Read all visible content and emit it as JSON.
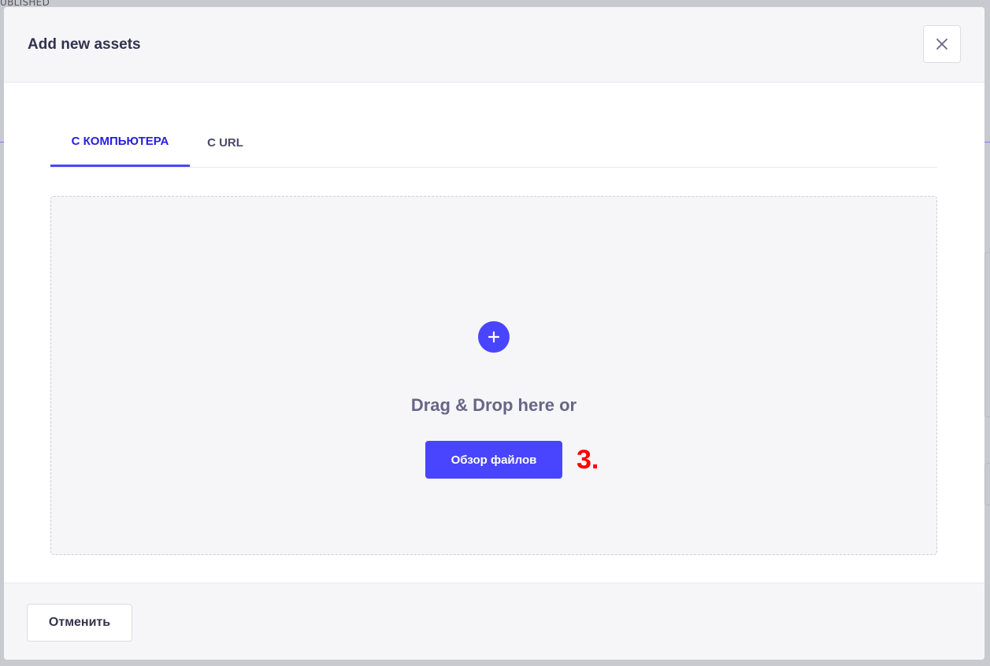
{
  "background": {
    "status_fragment": "UBLISHED"
  },
  "modal": {
    "title": "Add new assets",
    "close_icon": "close-icon",
    "tabs": [
      {
        "label": "С КОМПЬЮТЕРА",
        "active": true
      },
      {
        "label": "С URL",
        "active": false
      }
    ],
    "dropzone": {
      "icon": "plus-circle-icon",
      "text": "Drag & Drop here or",
      "browse_label": "Обзор файлов"
    },
    "step_marker": "3.",
    "footer": {
      "cancel_label": "Отменить"
    }
  },
  "colors": {
    "accent": "#4945ff",
    "active_tab_text": "#271fe0",
    "step_marker": "#ff0000"
  }
}
